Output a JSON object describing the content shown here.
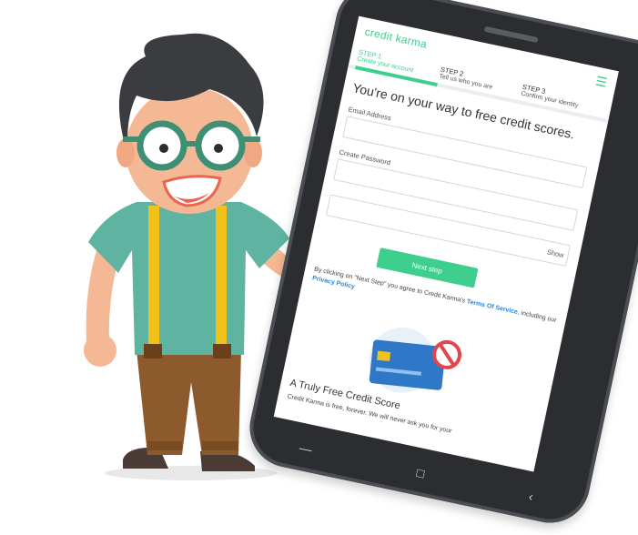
{
  "app": {
    "logo_text": "credit karma",
    "brand_color": "#3ecf8e",
    "link_color": "#1e88e5"
  },
  "steps": [
    {
      "num": "STEP 1",
      "label": "Create your account",
      "active": true
    },
    {
      "num": "STEP 2",
      "label": "Tell us who you are",
      "active": false
    },
    {
      "num": "STEP 3",
      "label": "Confirm your identity",
      "active": false
    }
  ],
  "headline": "You're on your way to free credit scores.",
  "form": {
    "email_label": "Email Address",
    "password_label": "Create Password",
    "show_label": "Show",
    "next_button": "Next step"
  },
  "legal": {
    "prefix": "By clicking on \"Next Step\" you agree to Credit Karma's ",
    "terms_link": "Terms Of Service",
    "middle": ", including our ",
    "privacy_link": "Privacy Policy"
  },
  "section": {
    "title": "A Truly Free Credit Score",
    "body": "Credit Karma is free, forever. We will never ask you for your"
  },
  "icons": {
    "menu": "hamburger-menu-icon",
    "back": "back-nav-icon",
    "home": "home-nav-icon",
    "recent": "recent-apps-nav-icon"
  }
}
